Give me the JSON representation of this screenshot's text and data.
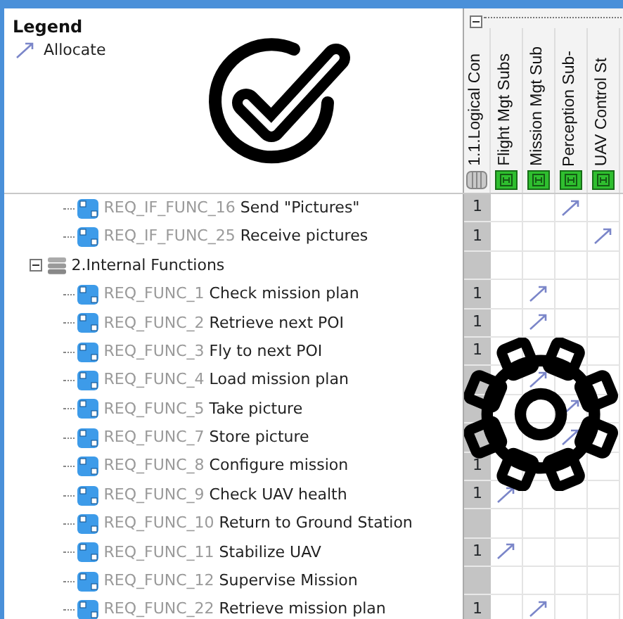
{
  "legend": {
    "title": "Legend",
    "items": [
      {
        "label": "Allocate"
      }
    ]
  },
  "columns": [
    {
      "label": "1.1.Logical Con",
      "kind": "package"
    },
    {
      "label": "Flight Mgt Subs",
      "kind": "block"
    },
    {
      "label": "Mission Mgt Sub",
      "kind": "block"
    },
    {
      "label": "Perception Sub-",
      "kind": "block"
    },
    {
      "label": "UAV Control St",
      "kind": "block"
    }
  ],
  "rows": [
    {
      "kind": "requirement",
      "id": "REQ_IF_FUNC_16",
      "name": "Send \"Pictures\"",
      "count": "1",
      "allocations": [
        false,
        false,
        true,
        false
      ]
    },
    {
      "kind": "requirement",
      "id": "REQ_IF_FUNC_25",
      "name": "Receive pictures",
      "count": "1",
      "allocations": [
        false,
        false,
        false,
        true
      ]
    },
    {
      "kind": "group",
      "label": "2.Internal Functions",
      "expanded": true,
      "children": [
        {
          "kind": "requirement",
          "id": "REQ_FUNC_1",
          "name": "Check mission plan",
          "count": "1",
          "allocations": [
            false,
            true,
            false,
            false
          ]
        },
        {
          "kind": "requirement",
          "id": "REQ_FUNC_2",
          "name": "Retrieve next POI",
          "count": "1",
          "allocations": [
            false,
            true,
            false,
            false
          ]
        },
        {
          "kind": "requirement",
          "id": "REQ_FUNC_3",
          "name": "Fly to next POI",
          "count": "1",
          "allocations": [
            false,
            false,
            false,
            false
          ]
        },
        {
          "kind": "requirement",
          "id": "REQ_FUNC_4",
          "name": "Load mission plan",
          "allocations": [
            false,
            true,
            false,
            false
          ]
        },
        {
          "kind": "requirement",
          "id": "REQ_FUNC_5",
          "name": "Take picture",
          "allocations": [
            false,
            false,
            true,
            false
          ]
        },
        {
          "kind": "requirement",
          "id": "REQ_FUNC_7",
          "name": "Store picture",
          "allocations": [
            false,
            false,
            true,
            false
          ]
        },
        {
          "kind": "requirement",
          "id": "REQ_FUNC_8",
          "name": "Configure mission",
          "count": "1",
          "allocations": [
            false,
            false,
            false,
            false
          ]
        },
        {
          "kind": "requirement",
          "id": "REQ_FUNC_9",
          "name": "Check UAV health",
          "count": "1",
          "allocations": [
            true,
            false,
            false,
            false
          ]
        },
        {
          "kind": "requirement",
          "id": "REQ_FUNC_10",
          "name": "Return to Ground Station",
          "allocations": [
            false,
            false,
            false,
            false
          ]
        },
        {
          "kind": "requirement",
          "id": "REQ_FUNC_11",
          "name": "Stabilize UAV",
          "count": "1",
          "allocations": [
            true,
            false,
            false,
            false
          ]
        },
        {
          "kind": "requirement",
          "id": "REQ_FUNC_12",
          "name": "Supervise Mission",
          "allocations": [
            false,
            false,
            false,
            false
          ]
        },
        {
          "kind": "requirement",
          "id": "REQ_FUNC_22",
          "name": "Retrieve mission plan",
          "count": "1",
          "allocations": [
            false,
            true,
            false,
            false
          ]
        }
      ]
    }
  ]
}
